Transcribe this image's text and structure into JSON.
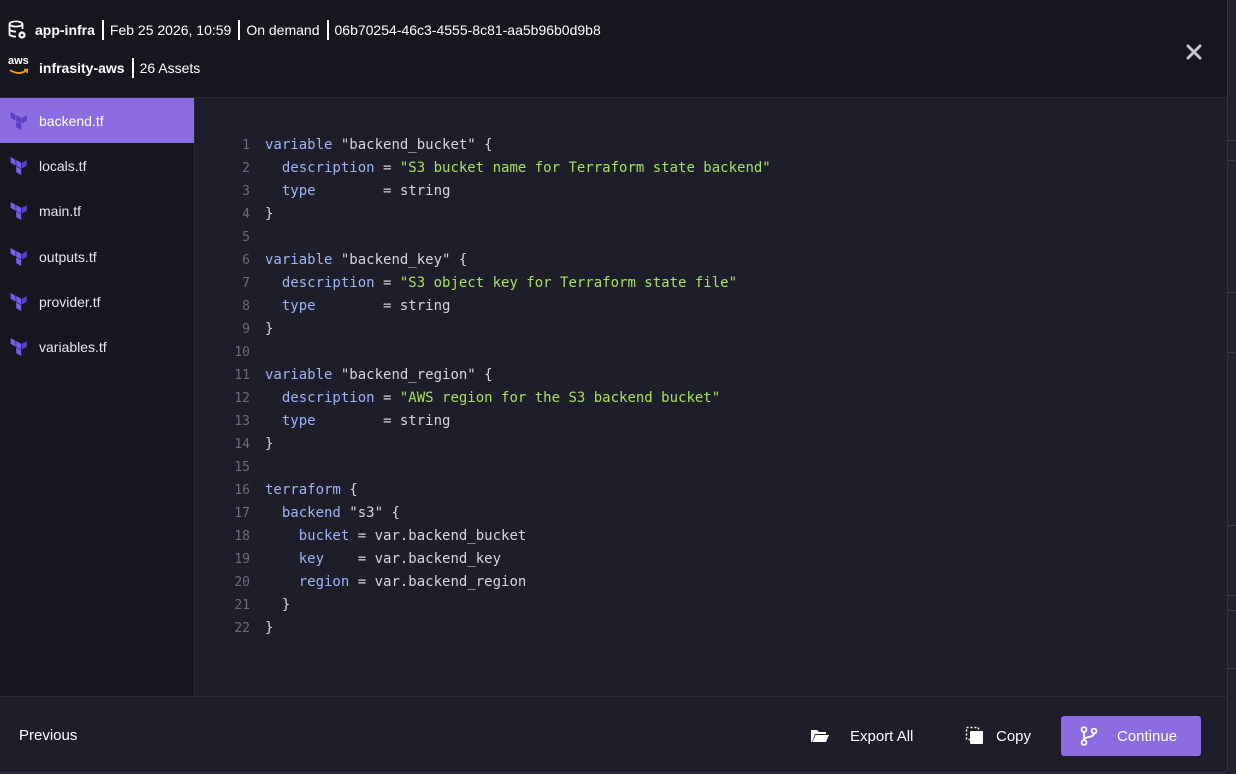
{
  "header": {
    "project": "app-infra",
    "date": "Feb 25 2026, 10:59",
    "trigger": "On demand",
    "run_id": "06b70254-46c3-4555-8c81-aa5b96b0d9b8",
    "provider_badge": "aws",
    "account": "infrasity-aws",
    "assets": "26 Assets"
  },
  "sidebar": {
    "files": [
      {
        "label": "backend.tf",
        "active": true
      },
      {
        "label": "locals.tf",
        "active": false
      },
      {
        "label": "main.tf",
        "active": false
      },
      {
        "label": "outputs.tf",
        "active": false
      },
      {
        "label": "provider.tf",
        "active": false
      },
      {
        "label": "variables.tf",
        "active": false
      }
    ]
  },
  "code": {
    "lines": [
      [
        {
          "t": "variable",
          "c": "kw"
        },
        {
          "t": " \"backend_bucket\" {",
          "c": ""
        }
      ],
      [
        {
          "t": "  ",
          "c": ""
        },
        {
          "t": "description",
          "c": "kw"
        },
        {
          "t": " = ",
          "c": ""
        },
        {
          "t": "\"S3 bucket name for Terraform state backend\"",
          "c": "str"
        }
      ],
      [
        {
          "t": "  ",
          "c": ""
        },
        {
          "t": "type",
          "c": "kw"
        },
        {
          "t": "        = string",
          "c": ""
        }
      ],
      [
        {
          "t": "}",
          "c": ""
        }
      ],
      [],
      [
        {
          "t": "variable",
          "c": "kw"
        },
        {
          "t": " \"backend_key\" {",
          "c": ""
        }
      ],
      [
        {
          "t": "  ",
          "c": ""
        },
        {
          "t": "description",
          "c": "kw"
        },
        {
          "t": " = ",
          "c": ""
        },
        {
          "t": "\"S3 object key for Terraform state file\"",
          "c": "str"
        }
      ],
      [
        {
          "t": "  ",
          "c": ""
        },
        {
          "t": "type",
          "c": "kw"
        },
        {
          "t": "        = string",
          "c": ""
        }
      ],
      [
        {
          "t": "}",
          "c": ""
        }
      ],
      [],
      [
        {
          "t": "variable",
          "c": "kw"
        },
        {
          "t": " \"backend_region\" {",
          "c": ""
        }
      ],
      [
        {
          "t": "  ",
          "c": ""
        },
        {
          "t": "description",
          "c": "kw"
        },
        {
          "t": " = ",
          "c": ""
        },
        {
          "t": "\"AWS region for the S3 backend bucket\"",
          "c": "str"
        }
      ],
      [
        {
          "t": "  ",
          "c": ""
        },
        {
          "t": "type",
          "c": "kw"
        },
        {
          "t": "        = string",
          "c": ""
        }
      ],
      [
        {
          "t": "}",
          "c": ""
        }
      ],
      [],
      [
        {
          "t": "terraform",
          "c": "kw"
        },
        {
          "t": " {",
          "c": ""
        }
      ],
      [
        {
          "t": "  ",
          "c": ""
        },
        {
          "t": "backend",
          "c": "kw"
        },
        {
          "t": " \"s3\" {",
          "c": ""
        }
      ],
      [
        {
          "t": "    ",
          "c": ""
        },
        {
          "t": "bucket",
          "c": "kw"
        },
        {
          "t": " = var.backend_bucket",
          "c": ""
        }
      ],
      [
        {
          "t": "    ",
          "c": ""
        },
        {
          "t": "key",
          "c": "kw"
        },
        {
          "t": "    = var.backend_key",
          "c": ""
        }
      ],
      [
        {
          "t": "    ",
          "c": ""
        },
        {
          "t": "region",
          "c": "kw"
        },
        {
          "t": " = var.backend_region",
          "c": ""
        }
      ],
      [
        {
          "t": "  }",
          "c": ""
        }
      ],
      [
        {
          "t": "}",
          "c": ""
        }
      ]
    ]
  },
  "footer": {
    "previous_label": "Previous",
    "export_label": "Export All",
    "copy_label": "Copy",
    "continue_label": "Continue"
  },
  "colors": {
    "accent": "#8c6ce0",
    "keyword": "#9fb4f5",
    "string": "#a6e35a"
  },
  "icons": {
    "project": "database-icon",
    "provider": "aws-logo-icon",
    "close": "close-icon",
    "file": "terraform-icon",
    "export": "folder-open-icon",
    "copy": "copy-icon",
    "continue": "git-branch-icon"
  }
}
